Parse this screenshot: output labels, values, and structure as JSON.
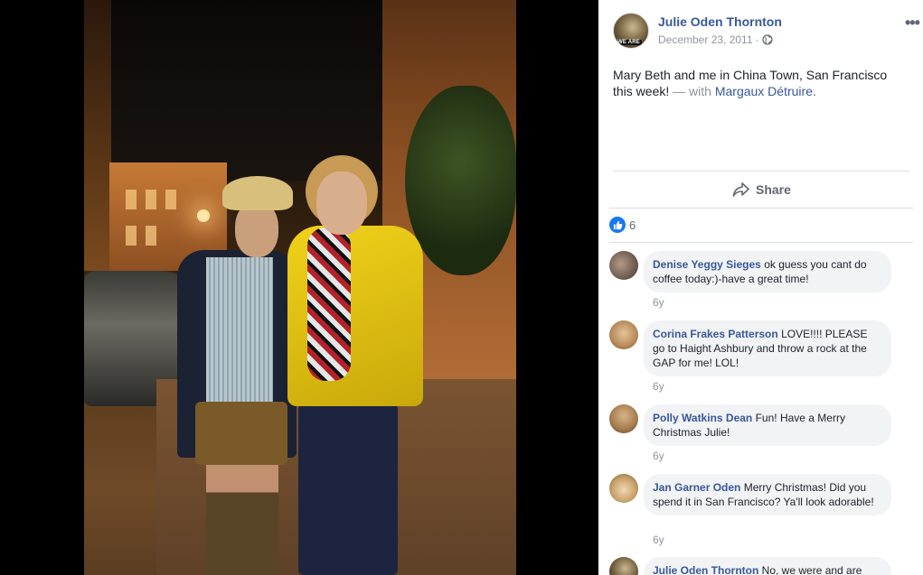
{
  "post": {
    "author": "Julie Oden Thornton",
    "avatar_badge": "WE ARE",
    "date": "December 23, 2011",
    "separator": "·",
    "privacy_icon": "globe-icon",
    "more_label": "•••",
    "text": "Mary Beth and me in China Town, San Francisco this week!",
    "with_prefix": "— with",
    "tagged": "Margaux Détruire",
    "tagged_suffix": "."
  },
  "actions": {
    "share_label": "Share",
    "share_icon": "share-arrow-icon"
  },
  "reactions": {
    "icon": "thumbs-up-icon",
    "count": "6",
    "color": "#1877f2"
  },
  "comments": [
    {
      "name": "Denise Yeggy Sieges",
      "text": "ok guess you cant do coffee today:)-have a great time!",
      "time": "6y"
    },
    {
      "name": "Corina Frakes Patterson",
      "text": "LOVE!!!! PLEASE go to Haight Ashbury and throw a rock at the GAP for me! LOL!",
      "time": "6y"
    },
    {
      "name": "Polly Watkins Dean",
      "text": "Fun! Have a Merry Christmas Julie!",
      "time": "6y"
    },
    {
      "name": "Jan Garner Oden",
      "text": "Merry Christmas! Did you spend it in San Francisco? Ya'll look adorable!",
      "time": "6y"
    },
    {
      "name": "Julie Oden Thornton",
      "text": "No, we were and are",
      "time": ""
    }
  ],
  "colors": {
    "link": "#385898",
    "muted": "#90949c",
    "bubble": "#f2f3f5"
  }
}
